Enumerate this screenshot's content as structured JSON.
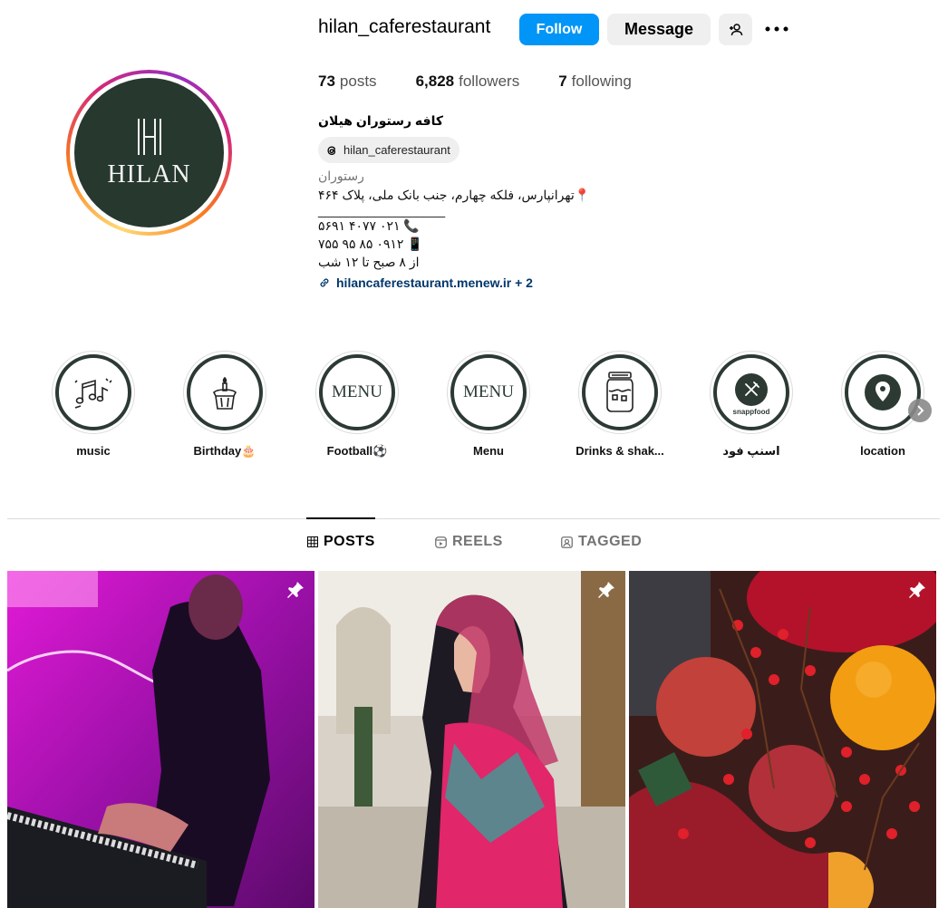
{
  "profile": {
    "username": "hilan_caferestaurant",
    "avatar_text": "HILAN",
    "follow_label": "Follow",
    "message_label": "Message",
    "suggest_icon": "person-add-icon",
    "more_icon": "more-horizontal-icon"
  },
  "stats": {
    "posts_count": "73",
    "posts_label": "posts",
    "followers_count": "6,828",
    "followers_label": "followers",
    "following_count": "7",
    "following_label": "following"
  },
  "bio": {
    "name": "کافه رستوران هیلان",
    "threads_handle": "hilan_caferestaurant",
    "category": "رستوران",
    "address": "📍تهرانپارس، فلکه چهارم، جنب بانک ملی، پلاک ۴۶۴",
    "separator": "__________________",
    "phone": "📞 ۰۲۱ ۴۰۷۷ ۵۶۹۱",
    "mobile": "📱 ۰۹۱۲ ۸۵ ۹۵ ۷۵۵",
    "hours": "از ۸ صبح تا ۱۲ شب",
    "link": "hilancaferestaurant.menew.ir + 2"
  },
  "highlights": [
    {
      "label": "music",
      "icon": "music-notes-icon"
    },
    {
      "label": "Birthday🎂",
      "icon": "birthday-cake-icon"
    },
    {
      "label": "Football⚽",
      "cover_text": "MENU"
    },
    {
      "label": "Menu",
      "cover_text": "MENU"
    },
    {
      "label": "Drinks & shak...",
      "icon": "jar-drink-icon"
    },
    {
      "label": "اسنپ فود",
      "cover_text": "snappfood",
      "icon": "fork-knife-icon"
    },
    {
      "label": "location",
      "icon": "location-pin-icon"
    }
  ],
  "tabs": [
    {
      "label": "POSTS",
      "active": true
    },
    {
      "label": "REELS",
      "active": false
    },
    {
      "label": "TAGGED",
      "active": false
    }
  ],
  "posts": [
    {
      "subject": "live-music-keyboard-player",
      "pinned": true
    },
    {
      "subject": "woman-in-patterned-scarf",
      "pinned": true
    },
    {
      "subject": "pomegranates-oranges-berries",
      "pinned": true
    }
  ],
  "colors": {
    "follow_blue": "#0095f6",
    "avatar_green": "#27382e",
    "link_blue": "#00376b",
    "muted_text": "#737373"
  }
}
